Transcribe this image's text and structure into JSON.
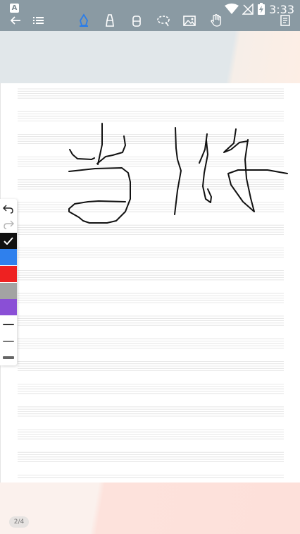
{
  "status_bar": {
    "app_badge": "A",
    "time": "3:33"
  },
  "toolbar": {
    "tools": [
      {
        "name": "back-icon",
        "active": false
      },
      {
        "name": "menu-icon",
        "active": false
      },
      {
        "name": "pen-icon",
        "active": true
      },
      {
        "name": "highlighter-icon",
        "active": false
      },
      {
        "name": "eraser-icon",
        "active": false
      },
      {
        "name": "lasso-icon",
        "active": false
      },
      {
        "name": "image-icon",
        "active": false
      },
      {
        "name": "hand-icon",
        "active": false
      },
      {
        "name": "notes-icon",
        "active": false
      }
    ],
    "active_color": "#2b7de9"
  },
  "palette": {
    "actions": [
      "undo-icon",
      "redo-icon"
    ],
    "colors": [
      "#111111",
      "#2f80ed",
      "#ee2121",
      "#a3a3a3",
      "#8a4fd6"
    ],
    "selected_color": "#111111",
    "stroke_widths": [
      "thin",
      "medium",
      "thick"
    ]
  },
  "page_indicator": "2/4"
}
